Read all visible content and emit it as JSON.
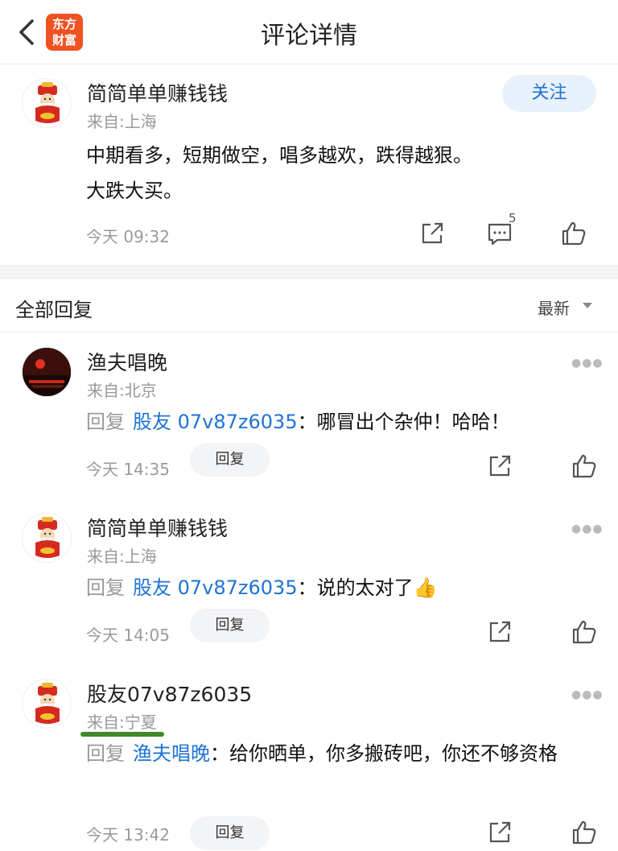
{
  "header": {
    "title": "评论详情",
    "logo_text": "东方财富",
    "logo_color": "#ef5322"
  },
  "post": {
    "username": "简简单单赚钱钱",
    "location": "来自:上海",
    "follow_label": "关注",
    "text_line1": "中期看多，短期做空，唱多越欢，跌得越狠。",
    "text_line2": "大跌大买。",
    "time": "今天 09:32",
    "comment_count": "5"
  },
  "section": {
    "title": "全部回复",
    "sort_label": "最新"
  },
  "replies": [
    {
      "username": "渔夫唱晚",
      "location": "来自:北京",
      "reply_label": "回复",
      "target": "股友 07v87z6035",
      "text": "：哪冒出个杂仲！哈哈！",
      "time": "今天 14:35",
      "reply_button": "回复"
    },
    {
      "username": "简简单单赚钱钱",
      "location": "来自:上海",
      "reply_label": "回复",
      "target": "股友 07v87z6035",
      "text": "：说的太对了",
      "emoji": "👍",
      "time": "今天 14:05",
      "reply_button": "回复"
    },
    {
      "username": "股友07v87z6035",
      "location": "来自:宁夏",
      "reply_label": "回复",
      "target": "渔夫唱晚",
      "text": "：给你晒单，你多搬砖吧，你还不够资格",
      "time": "今天 13:42",
      "reply_button": "回复"
    }
  ],
  "colors": {
    "accent": "#1f73d6",
    "follow_bg": "#e8f1fc",
    "underline": "#3e8a2a"
  }
}
